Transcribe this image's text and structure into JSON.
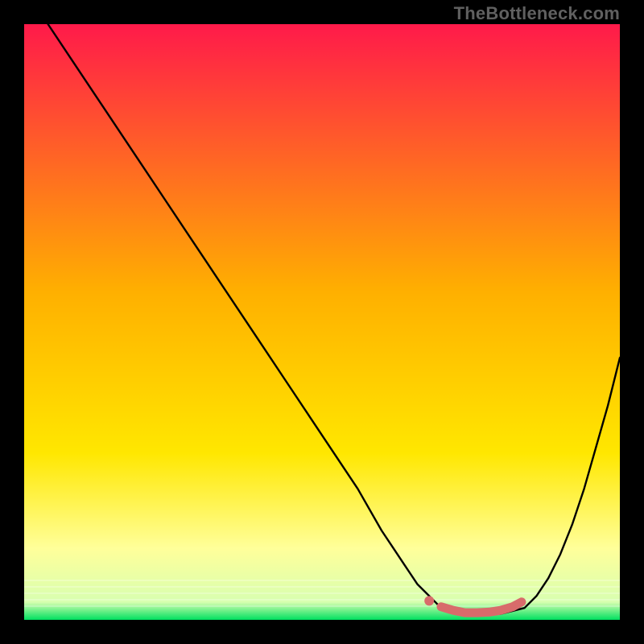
{
  "attribution": "TheBottleneck.com",
  "colors": {
    "frame": "#000000",
    "gradient_top": "#ff1a4a",
    "gradient_mid": "#ffd400",
    "gradient_lightyellow": "#ffff9a",
    "gradient_bottom": "#00e060",
    "curve": "#000000",
    "highlight": "#d86b6b",
    "highlight_dot": "#d86b6b"
  },
  "chart_data": {
    "type": "line",
    "title": "",
    "xlabel": "",
    "ylabel": "",
    "xlim": [
      0,
      100
    ],
    "ylim": [
      0,
      100
    ],
    "series": [
      {
        "name": "bottleneck-curve",
        "x": [
          4,
          8,
          12,
          16,
          20,
          24,
          28,
          32,
          36,
          40,
          44,
          48,
          52,
          56,
          60,
          62,
          64,
          66,
          68,
          70,
          72,
          74,
          76,
          78,
          80,
          82,
          84,
          86,
          88,
          90,
          92,
          94,
          96,
          98,
          100
        ],
        "y": [
          100,
          94,
          88,
          82,
          76,
          70,
          64,
          58,
          52,
          46,
          40,
          34,
          28,
          22,
          15,
          12,
          9,
          6,
          4,
          2,
          1.5,
          1,
          1,
          1,
          1,
          1.5,
          2,
          4,
          7,
          11,
          16,
          22,
          29,
          36,
          44
        ]
      }
    ],
    "highlight_segment": {
      "dot": {
        "x": 68,
        "y": 3.2
      },
      "path_x": [
        70,
        72,
        74,
        76,
        78,
        80,
        82,
        83.5
      ],
      "path_y": [
        2.2,
        1.6,
        1.2,
        1.2,
        1.3,
        1.6,
        2.2,
        3.0
      ]
    }
  }
}
